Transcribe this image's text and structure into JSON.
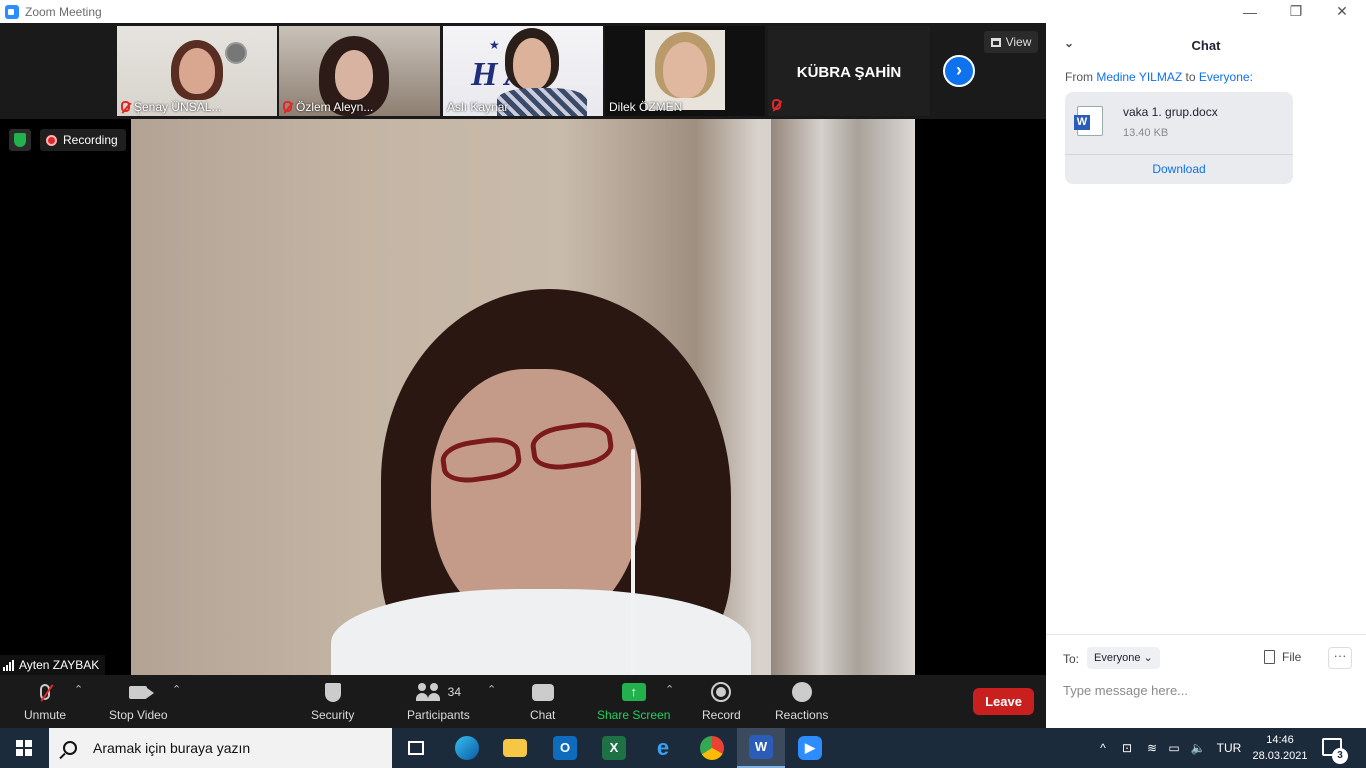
{
  "window": {
    "title": "Zoom Meeting"
  },
  "thumbnails": [
    {
      "name": "Şenay ÜNSAL...",
      "muted": true
    },
    {
      "name": "Özlem Aleyn...",
      "muted": true
    },
    {
      "name": "Aslı Kaynar",
      "muted": false,
      "logo": "H  AK"
    },
    {
      "name": "Dilek ÖZMEN",
      "muted": false
    },
    {
      "name": "KÜBRA ŞAHİN",
      "muted": true
    }
  ],
  "view_button": {
    "label": "View"
  },
  "recording": {
    "label": "Recording"
  },
  "active_speaker": {
    "name": "Ayten ZAYBAK"
  },
  "toolbar": {
    "unmute": "Unmute",
    "stop_video": "Stop Video",
    "security": "Security",
    "participants": "Participants",
    "participants_count": "34",
    "chat": "Chat",
    "share_screen": "Share Screen",
    "record": "Record",
    "reactions": "Reactions",
    "leave": "Leave"
  },
  "chat": {
    "title": "Chat",
    "from_prefix": "From",
    "sender": "Medine YILMAZ",
    "to_word": "to",
    "recipient": "Everyone:",
    "file": {
      "name": "vaka 1. grup.docx",
      "size": "13.40 KB",
      "download": "Download",
      "icon_letter": "W"
    },
    "to_label": "To:",
    "to_value": "Everyone",
    "file_button": "File",
    "more_button": "···",
    "message_placeholder": "Type message here..."
  },
  "taskbar": {
    "search_placeholder": "Aramak için buraya yazın",
    "language": "TUR",
    "time": "14:46",
    "date": "28.03.2021",
    "notifications": "3"
  },
  "colors": {
    "zoom_blue": "#0e72ed",
    "leave_red": "#c91f1f",
    "share_green": "#23b14d",
    "taskbar": "#1c2b3c"
  }
}
